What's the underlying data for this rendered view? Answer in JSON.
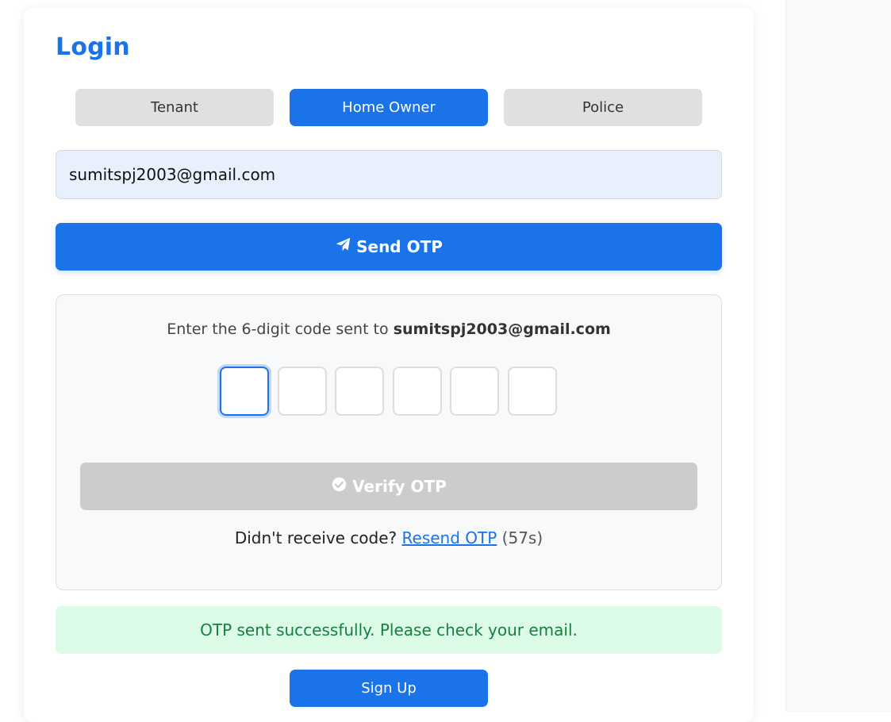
{
  "login": {
    "title": "Login",
    "roles": [
      {
        "label": "Tenant",
        "active": false
      },
      {
        "label": "Home Owner",
        "active": true
      },
      {
        "label": "Police",
        "active": false
      }
    ],
    "email_value": "sumitspj2003@gmail.com",
    "send_otp_label": "Send OTP"
  },
  "otp": {
    "prompt": "Enter the 6-digit code sent to",
    "email": "sumitspj2003@gmail.com",
    "digits": [
      "",
      "",
      "",
      "",
      "",
      ""
    ],
    "verify_label": "Verify OTP",
    "resend_prompt": "Didn't receive code?",
    "resend_label": "Resend OTP",
    "timer": "(57s)"
  },
  "status": {
    "message": "OTP sent successfully. Please check your email."
  },
  "signup_label": "Sign Up",
  "colors": {
    "accent": "#1a73e8",
    "disabled": "#cccccc",
    "success_bg": "#dcfce7",
    "success_text": "#15803d"
  },
  "icons": {
    "send": "paper-plane-icon",
    "verify": "check-circle-icon"
  }
}
